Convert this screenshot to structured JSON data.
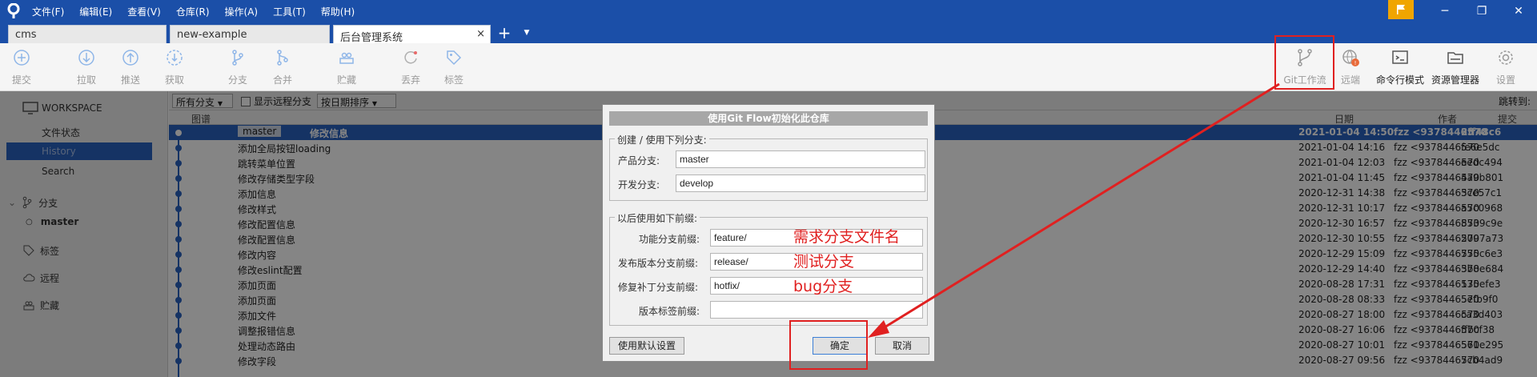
{
  "menu": [
    "文件(F)",
    "编辑(E)",
    "查看(V)",
    "仓库(R)",
    "操作(A)",
    "工具(T)",
    "帮助(H)"
  ],
  "tabs": [
    {
      "label": "cms"
    },
    {
      "label": "new-example"
    },
    {
      "label": "后台管理系统",
      "close": "×"
    }
  ],
  "new_tab": "+",
  "window_controls": {
    "minimize": "─",
    "maximize": "❐",
    "close": "✕"
  },
  "toolbar": {
    "commit": "提交",
    "pull": "拉取",
    "push": "推送",
    "fetch": "获取",
    "branch": "分支",
    "merge": "合并",
    "stash": "贮藏",
    "discard": "丢弃",
    "tag": "标签",
    "git_flow": "Git工作流",
    "remote": "远端",
    "terminal": "命令行模式",
    "explorer": "资源管理器",
    "settings": "设置"
  },
  "sidebar": {
    "workspace": "WORKSPACE",
    "file_status": "文件状态",
    "history": "History",
    "search": "Search",
    "branches": "分支",
    "master": "master",
    "tags": "标签",
    "remotes": "远程",
    "stashes": "贮藏"
  },
  "filters": {
    "all_branches": "所有分支",
    "show_remote": "显示远程分支",
    "sort_by_date": "按日期排序",
    "jump_to": "跳转到:"
  },
  "columns": {
    "graph": "图谱",
    "date": "日期",
    "author": "作者",
    "commit": "提交"
  },
  "commits": [
    {
      "branch": "master",
      "desc": "修改信息",
      "date": "2021-01-04 14:50",
      "author": "fzz <9378446570",
      "hash": "2ff48c6"
    },
    {
      "desc": "添加全局按钮loading",
      "date": "2021-01-04 14:16",
      "author": "fzz <9378446570",
      "hash": "fe6e5dc"
    },
    {
      "desc": "跳转菜单位置",
      "date": "2021-01-04 12:03",
      "author": "fzz <9378446570",
      "hash": "eedc494"
    },
    {
      "desc": "修改存储类型字段",
      "date": "2021-01-04 11:45",
      "author": "fzz <9378446570",
      "hash": "4a9b801"
    },
    {
      "desc": "添加信息",
      "date": "2020-12-31 14:38",
      "author": "fzz <9378446570",
      "hash": "3ce57c1"
    },
    {
      "desc": "修改样式",
      "date": "2020-12-31 10:17",
      "author": "fzz <9378446570",
      "hash": "a5c0968"
    },
    {
      "desc": "修改配置信息",
      "date": "2020-12-30 16:57",
      "author": "fzz <9378446570",
      "hash": "8539c9e"
    },
    {
      "desc": "修改配置信息",
      "date": "2020-12-30 10:55",
      "author": "fzz <9378446570",
      "hash": "2097a73"
    },
    {
      "desc": "修改内容",
      "date": "2020-12-29 15:09",
      "author": "fzz <9378446570",
      "hash": "755c6e3"
    },
    {
      "desc": "修改eslint配置",
      "date": "2020-12-29 14:40",
      "author": "fzz <9378446570",
      "hash": "3b8e684"
    },
    {
      "desc": "添加页面",
      "date": "2020-08-28 17:31",
      "author": "fzz <9378446570",
      "hash": "135efe3"
    },
    {
      "desc": "添加页面",
      "date": "2020-08-28 08:33",
      "author": "fzz <9378446570",
      "hash": "5efb9f0"
    },
    {
      "desc": "添加文件",
      "date": "2020-08-27 18:00",
      "author": "fzz <9378446570",
      "hash": "ca3d403"
    },
    {
      "desc": "调整报错信息",
      "date": "2020-08-27 16:06",
      "author": "fzz <9378446570",
      "hash": "ffbcf38"
    },
    {
      "desc": "处理动态路由",
      "date": "2020-08-27 10:01",
      "author": "fzz <9378446570",
      "hash": "561e295"
    },
    {
      "desc": "修改字段",
      "date": "2020-08-27 09:56",
      "author": "fzz <9378446570",
      "hash": "7cb4ad9"
    }
  ],
  "dialog": {
    "title": "使用Git Flow初始化此仓库",
    "group1_label": "创建 / 使用下列分支:",
    "production_label": "产品分支:",
    "production_value": "master",
    "development_label": "开发分支:",
    "development_value": "develop",
    "group2_label": "以后使用如下前缀:",
    "feature_label": "功能分支前缀:",
    "feature_value": "feature/",
    "release_label": "发布版本分支前缀:",
    "release_value": "release/",
    "hotfix_label": "修复补丁分支前缀:",
    "hotfix_value": "hotfix/",
    "tag_label": "版本标签前缀:",
    "tag_value": "",
    "defaults_button": "使用默认设置",
    "ok_button": "确定",
    "cancel_button": "取消"
  },
  "annotations": {
    "feature": "需求分支文件名",
    "release": "测试分支",
    "hotfix": "bug分支"
  },
  "colors": {
    "accent": "#1b4fa8",
    "selection": "#2a62c0",
    "annotation": "#e02020"
  }
}
